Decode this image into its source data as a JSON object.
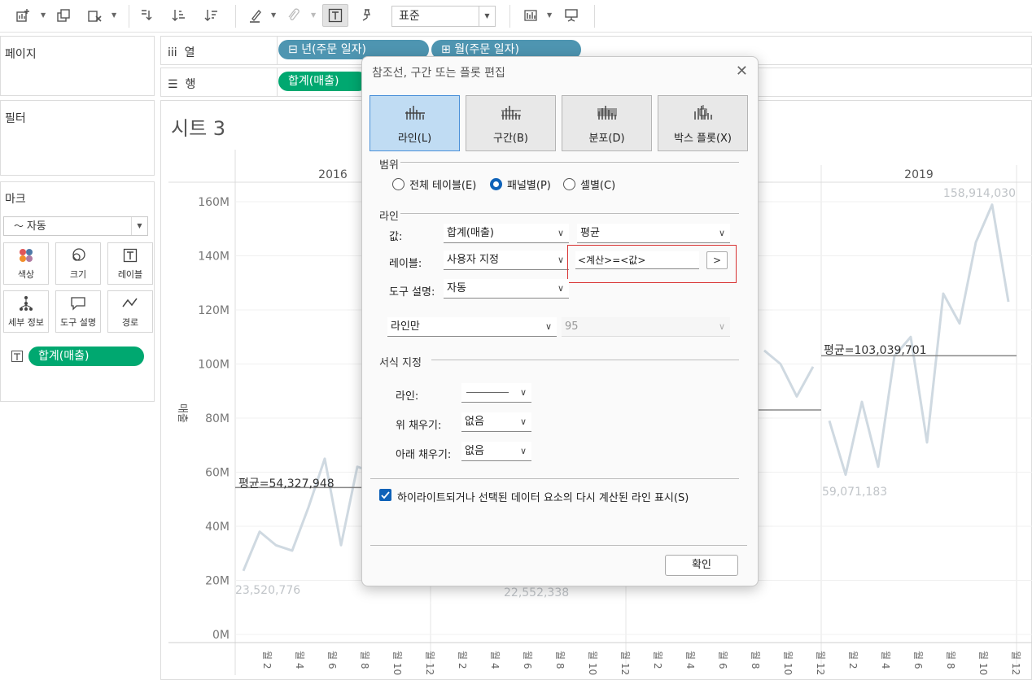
{
  "toolbar": {
    "fit_value": "표준",
    "icons": [
      "new-sheet-icon",
      "duplicate-icon",
      "clear-sheet-icon",
      "swap-icon",
      "sort-ascending-icon",
      "sort-descending-icon",
      "highlight-icon",
      "annotate-icon",
      "show-labels-icon",
      "pin-icon",
      "show-me-icon",
      "presentation-icon"
    ]
  },
  "panes": {
    "pages": "페이지",
    "filters": "필터",
    "marks": "마크",
    "mark_type": "자동",
    "mark_buttons": {
      "color": "색상",
      "size": "크기",
      "label": "레이블",
      "detail": "세부 정보",
      "tooltip": "도구 설명",
      "path": "경로"
    },
    "mark_pill": "합계(매출)"
  },
  "shelves": {
    "columns_label": "열",
    "rows_label": "행",
    "column_pills": [
      "년(주문 일자)",
      "월(주문 일자)"
    ],
    "row_pill": "합계(매출)"
  },
  "sheet": {
    "title": "시트 3",
    "y_axis_title": "매출",
    "y_ticks": [
      "160M",
      "140M",
      "120M",
      "100M",
      "80M",
      "60M",
      "40M",
      "20M",
      "0M"
    ],
    "year_headers": [
      "2016",
      "2019"
    ],
    "month_ticks": [
      "2",
      "4",
      "6",
      "8",
      "10",
      "12"
    ],
    "month_unit": "월",
    "labels": {
      "avg_2016": "평균=54,327,948",
      "min_2016": "23,520,776",
      "min_2017": "22,552,338",
      "avg_2019": "평균=103,039,701",
      "min_2019": "59,071,183",
      "max_2019": "158,914,030"
    }
  },
  "chart_data": {
    "type": "line",
    "ylim": [
      0,
      170000000
    ],
    "series": [
      {
        "panel": "2016",
        "x": [
          1,
          2,
          3,
          4,
          5,
          6,
          7,
          8,
          9
        ],
        "values": [
          23520776,
          38000000,
          33000000,
          31000000,
          47000000,
          65000000,
          33000000,
          62000000,
          60000000
        ],
        "average": 54327948
      },
      {
        "panel": "2018",
        "x": [
          9,
          10,
          11,
          12
        ],
        "values": [
          105000000,
          100000000,
          88000000,
          99000000
        ],
        "average": 83000000
      },
      {
        "panel": "2019",
        "x": [
          1,
          2,
          3,
          4,
          5,
          6,
          7,
          8,
          9,
          10,
          11,
          12
        ],
        "values": [
          79000000,
          59071183,
          86000000,
          62000000,
          103000000,
          110000000,
          71000000,
          126000000,
          115000000,
          145000000,
          158914030,
          123000000
        ],
        "average": 103039701
      }
    ]
  },
  "dialog": {
    "title": "참조선, 구간 또는 플롯 편집",
    "tabs": [
      "라인(L)",
      "구간(B)",
      "분포(D)",
      "박스 플롯(X)"
    ],
    "scope_label": "범위",
    "scope_options": [
      "전체 테이블(E)",
      "패널별(P)",
      "셀별(C)"
    ],
    "scope_selected": "패널별(P)",
    "line_section": "라인",
    "value_label": "값:",
    "value_field": "합계(매출)",
    "value_agg": "평균",
    "label_label": "레이블:",
    "label_mode": "사용자 지정",
    "label_text": "<계산>=<값>",
    "label_insert_button": ">",
    "tooltip_label": "도구 설명:",
    "tooltip_mode": "자동",
    "line_mode": "라인만",
    "confidence_value": "95",
    "format_section": "서식 지정",
    "format_line_label": "라인:",
    "fill_above_label": "위 채우기:",
    "fill_above_value": "없음",
    "fill_below_label": "아래 채우기:",
    "fill_below_value": "없음",
    "recalc_checkbox": "하이라이트되거나 선택된 데이터 요소의 다시 계산된 라인 표시(S)",
    "ok_button": "확인"
  }
}
